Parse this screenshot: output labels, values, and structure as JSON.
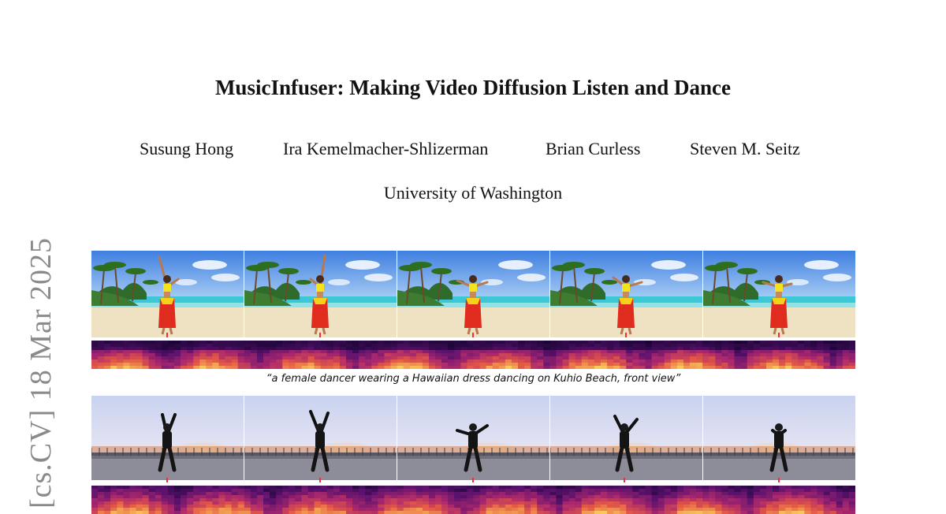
{
  "paper": {
    "title": "MusicInfuser: Making Video Diffusion Listen and Dance",
    "authors": [
      "Susung Hong",
      "Ira Kemelmacher-Shlizerman",
      "Brian Curless",
      "Steven M. Seitz"
    ],
    "affiliation": "University of Washington"
  },
  "arxiv_stamp": "[cs.CV]  18 Mar 2025",
  "figure": {
    "rows": [
      {
        "scene": "beach",
        "caption": "“a female dancer wearing a Hawaiian dress dancing on Kuhio Beach, front view”",
        "frame_count": 5
      },
      {
        "scene": "boardwalk-sunset",
        "frame_count": 5
      }
    ],
    "colors": {
      "beat_marker": "#ff2a2a",
      "spectrogram_low": "#1a0433",
      "spectrogram_high": "#f7a04a"
    }
  }
}
